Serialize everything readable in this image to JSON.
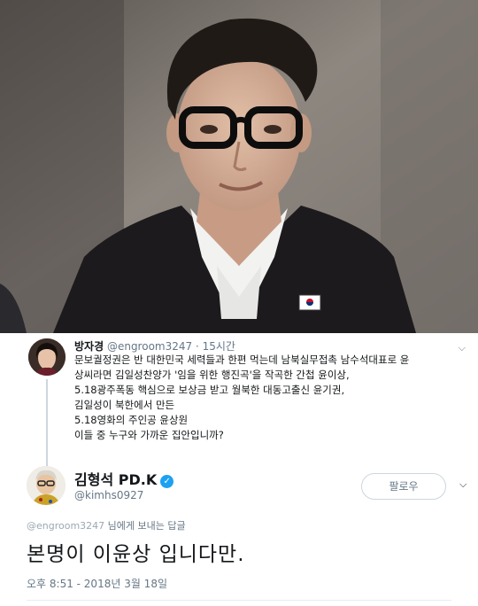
{
  "tweet_original": {
    "display_name": "방자경",
    "handle": "@engroom3247",
    "separator": "·",
    "time_ago": "15시간",
    "body_lines": [
      "문보궐정권은 반 대한민국 세력들과 한편 먹는데 남북실무접촉 남수석대표로 윤",
      "상씨라면 김일성찬양가 '임을 위한 행진곡'을 작곡한 간첩 윤이상,",
      "5.18광주폭동 핵심으로 보상금 받고 월북한 대동고출신 윤기권,",
      "김일성이 북한에서 만든",
      "5.18영화의 주인공 윤상원",
      "이들 중 누구와 가까운 집안입니까?"
    ]
  },
  "tweet_reply": {
    "display_name": "김형석 PD.K",
    "handle": "@kimhs0927",
    "follow_label": "팔로우",
    "reply_to_handle": "@engroom3247",
    "reply_to_suffix": " 님에게 보내는 답글",
    "text": "본명이 이윤상 입니다만.",
    "timestamp": "오후 8:51 - 2018년 3월 18일"
  },
  "icons": {
    "verified": "verified-badge-icon",
    "menu": "chevron-down-icon"
  },
  "colors": {
    "verified_blue": "#1da1f2",
    "secondary_text": "#657786",
    "primary_text": "#14171a",
    "border": "#ccd6dd"
  }
}
